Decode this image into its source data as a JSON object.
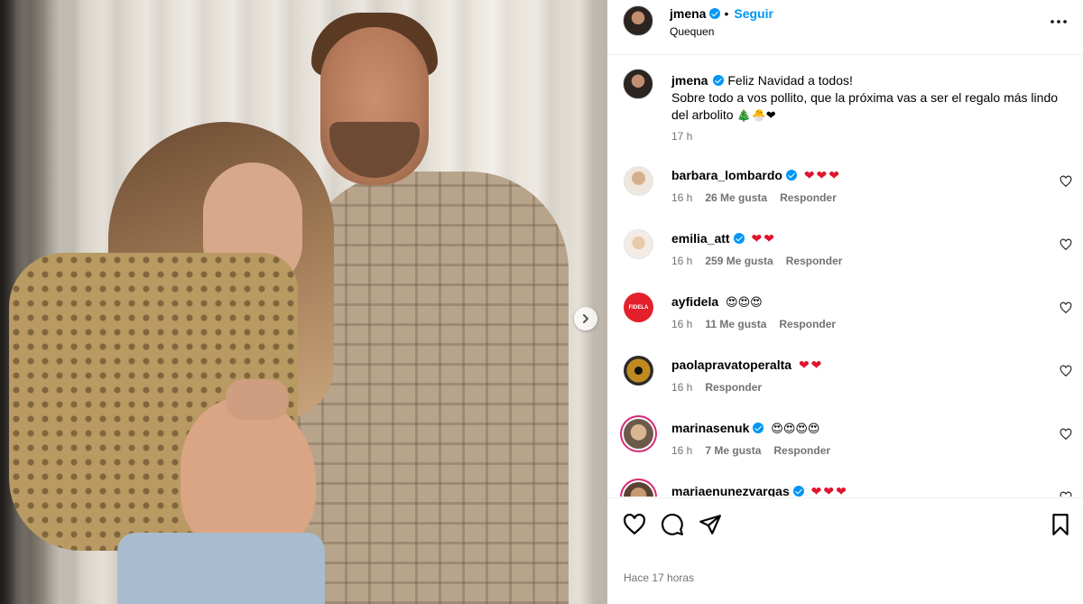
{
  "header": {
    "username": "jmena",
    "follow_label": "Seguir",
    "location": "Quequen"
  },
  "caption": {
    "username": "jmena",
    "line1": "Feliz Navidad a todos!",
    "line2": "Sobre todo a vos pollito, que la próxima vas a ser el regalo más lindo del arbolito",
    "emojis": "🎄🐣❤",
    "time": "17 h"
  },
  "comments": [
    {
      "username": "barbara_lombardo",
      "verified": true,
      "text": "❤❤❤",
      "time": "16 h",
      "likes": "26 Me gusta",
      "reply": "Responder"
    },
    {
      "username": "emilia_att",
      "verified": true,
      "text": "❤❤",
      "time": "16 h",
      "likes": "259 Me gusta",
      "reply": "Responder"
    },
    {
      "username": "ayfidela",
      "verified": false,
      "text": "😍😍😍",
      "time": "16 h",
      "likes": "11 Me gusta",
      "reply": "Responder",
      "avatar_text": "FIDELA"
    },
    {
      "username": "paolapravatoperalta",
      "verified": false,
      "text": "❤❤",
      "time": "16 h",
      "likes": "",
      "reply": "Responder"
    },
    {
      "username": "marinasenuk",
      "verified": true,
      "text": "😍😍😍😍",
      "time": "16 h",
      "likes": "7 Me gusta",
      "reply": "Responder"
    },
    {
      "username": "mariaenunezvargas",
      "verified": true,
      "text": "❤❤❤",
      "time": "",
      "likes": "",
      "reply": ""
    }
  ],
  "footer": {
    "timestamp": "Hace 17 horas"
  },
  "icons": {
    "carousel_next": "chevron-right-icon",
    "more": "more-options-icon",
    "like": "heart-outline-icon",
    "comment": "comment-bubble-icon",
    "share": "paper-plane-icon",
    "save": "bookmark-icon"
  },
  "colors": {
    "accent": "#0095f6",
    "heart": "#e0142c",
    "muted": "#737373"
  }
}
